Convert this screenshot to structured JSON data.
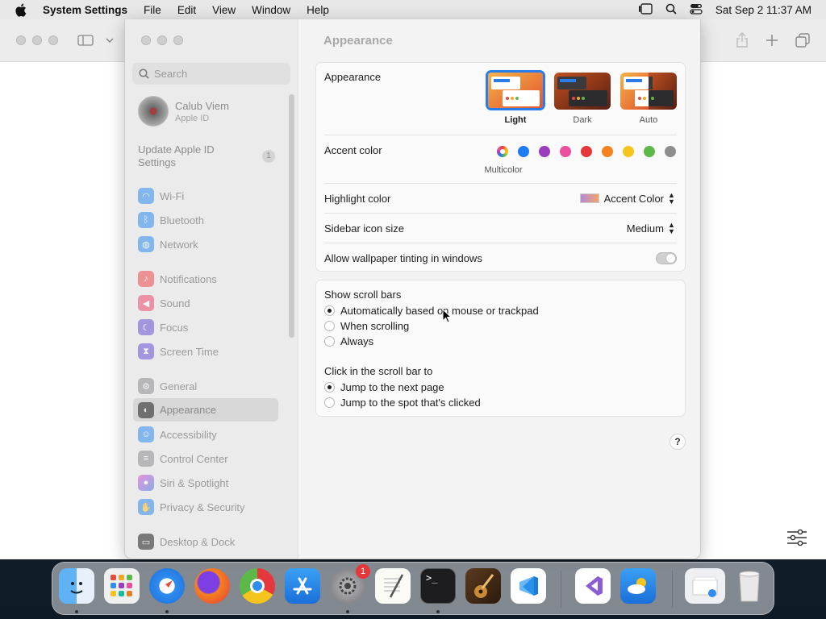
{
  "menubar": {
    "app_name": "System Settings",
    "menus": [
      "File",
      "Edit",
      "View",
      "Window",
      "Help"
    ],
    "datetime": "Sat Sep 2  11:37 AM"
  },
  "sidebar": {
    "search_placeholder": "Search",
    "user": {
      "name": "Calub Viem",
      "subtitle": "Apple ID"
    },
    "update": {
      "label": "Update Apple ID Settings",
      "badge": "1"
    },
    "items": [
      {
        "label": "Wi-Fi",
        "icon": "wifi-icon",
        "color": "#2f8cf0"
      },
      {
        "label": "Bluetooth",
        "icon": "bluetooth-icon",
        "color": "#2f8cf0"
      },
      {
        "label": "Network",
        "icon": "globe-icon",
        "color": "#2f8cf0"
      },
      {
        "label": "Notifications",
        "icon": "bell-icon",
        "color": "#ef4b4b"
      },
      {
        "label": "Sound",
        "icon": "speaker-icon",
        "color": "#ef4b6d"
      },
      {
        "label": "Focus",
        "icon": "moon-icon",
        "color": "#6a52d6"
      },
      {
        "label": "Screen Time",
        "icon": "hourglass-icon",
        "color": "#6a52d6"
      },
      {
        "label": "General",
        "icon": "gear-icon",
        "color": "#8e8e93"
      },
      {
        "label": "Appearance",
        "icon": "appearance-icon",
        "color": "#1d1d1f"
      },
      {
        "label": "Accessibility",
        "icon": "accessibility-icon",
        "color": "#2f8cf0"
      },
      {
        "label": "Control Center",
        "icon": "control-center-icon",
        "color": "#8e8e93"
      },
      {
        "label": "Siri & Spotlight",
        "icon": "siri-icon",
        "color": "#c24ad6"
      },
      {
        "label": "Privacy & Security",
        "icon": "hand-icon",
        "color": "#2f8cf0"
      },
      {
        "label": "Desktop & Dock",
        "icon": "dock-icon",
        "color": "#1d1d1f"
      }
    ]
  },
  "content": {
    "title": "Appearance",
    "appearance": {
      "label": "Appearance",
      "options": [
        "Light",
        "Dark",
        "Auto"
      ],
      "selected": "Light"
    },
    "accent": {
      "label": "Accent color",
      "caption": "Multicolor",
      "colors": [
        "#f5a623",
        "#1f7cf5",
        "#9b3ebd",
        "#eb4f9d",
        "#e5373c",
        "#f5821f",
        "#f6c51d",
        "#5cb947",
        "#8e8e8e"
      ]
    },
    "highlight": {
      "label": "Highlight color",
      "value": "Accent Color"
    },
    "sidebar_icon": {
      "label": "Sidebar icon size",
      "value": "Medium"
    },
    "tinting": {
      "label": "Allow wallpaper tinting in windows",
      "enabled": false
    },
    "scroll_bars": {
      "label": "Show scroll bars",
      "options": [
        "Automatically based on mouse or trackpad",
        "When scrolling",
        "Always"
      ],
      "selected": 0
    },
    "click_scroll": {
      "label": "Click in the scroll bar to",
      "options": [
        "Jump to the next page",
        "Jump to the spot that's clicked"
      ],
      "selected": 0
    },
    "help": "?"
  },
  "dock": {
    "apps": [
      "Finder",
      "Launchpad",
      "Safari",
      "Firefox",
      "Chrome",
      "App Store",
      "System Settings",
      "TextEdit",
      "Terminal",
      "Instruments",
      "VS Code",
      "Visual Studio",
      "Weather",
      "Downloads",
      "Trash"
    ],
    "settings_badge": "1"
  }
}
